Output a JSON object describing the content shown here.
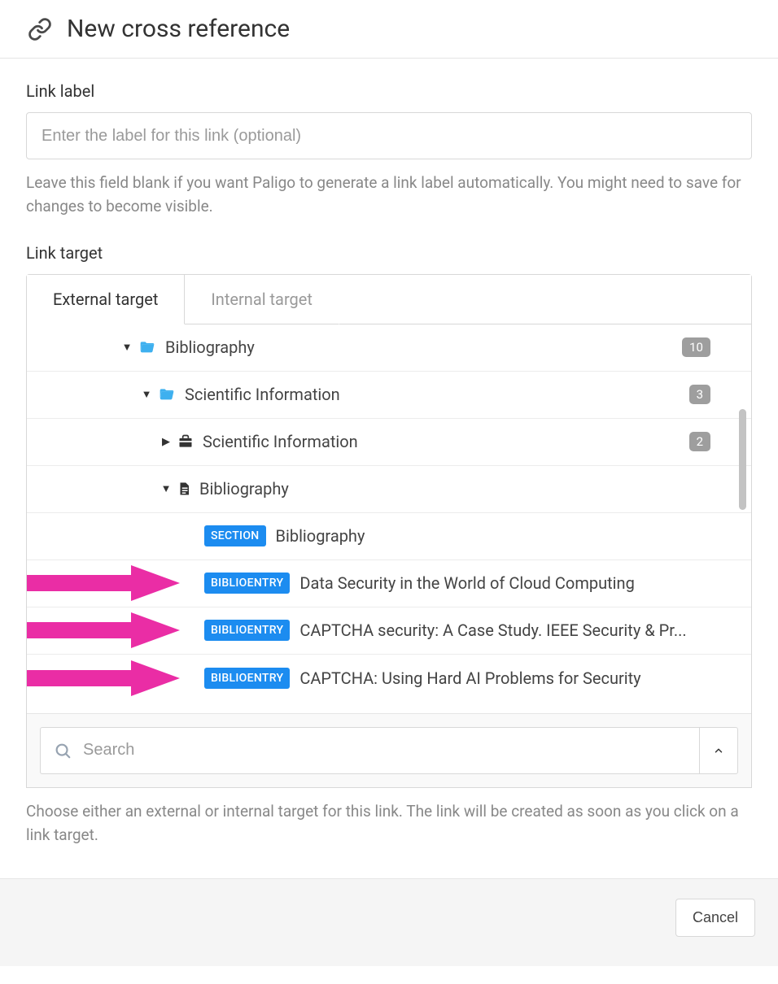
{
  "header": {
    "title": "New cross reference"
  },
  "linkLabel": {
    "label": "Link label",
    "placeholder": "Enter the label for this link (optional)",
    "help": "Leave this field blank if you want Paligo to generate a link label automatically. You might need to save for changes to become visible."
  },
  "linkTarget": {
    "label": "Link target",
    "help": "Choose either an external or internal target for this link. The link will be created as soon as you click on a link target."
  },
  "tabs": {
    "external": "External target",
    "internal": "Internal target"
  },
  "tree": {
    "rows": [
      {
        "indent": 116,
        "arrow": "down",
        "icon": "folder",
        "label": "Bibliography",
        "badge": "10"
      },
      {
        "indent": 140,
        "arrow": "down",
        "icon": "folder",
        "label": "Scientific Information",
        "badge": "3"
      },
      {
        "indent": 164,
        "arrow": "right",
        "icon": "briefcase",
        "label": "Scientific Information",
        "badge": "2"
      },
      {
        "indent": 164,
        "arrow": "down",
        "icon": "document",
        "label": "Bibliography"
      },
      {
        "indent": 218,
        "tag": "SECTION",
        "label": "Bibliography"
      },
      {
        "indent": 218,
        "tag": "BIBLIOENTRY",
        "label": "Data Security in the World of Cloud Computing",
        "annotated": true
      },
      {
        "indent": 218,
        "tag": "BIBLIOENTRY",
        "label": "CAPTCHA security: A Case Study. IEEE Security & Pr...",
        "annotated": true
      },
      {
        "indent": 218,
        "tag": "BIBLIOENTRY",
        "label": "CAPTCHA: Using Hard AI Problems for Security",
        "annotated": true
      }
    ]
  },
  "search": {
    "placeholder": "Search"
  },
  "footer": {
    "cancel": "Cancel"
  },
  "colors": {
    "accentBlue": "#1c8cf0",
    "folderBlue": "#3eb0ef",
    "annotationPink": "#ea2da5"
  }
}
